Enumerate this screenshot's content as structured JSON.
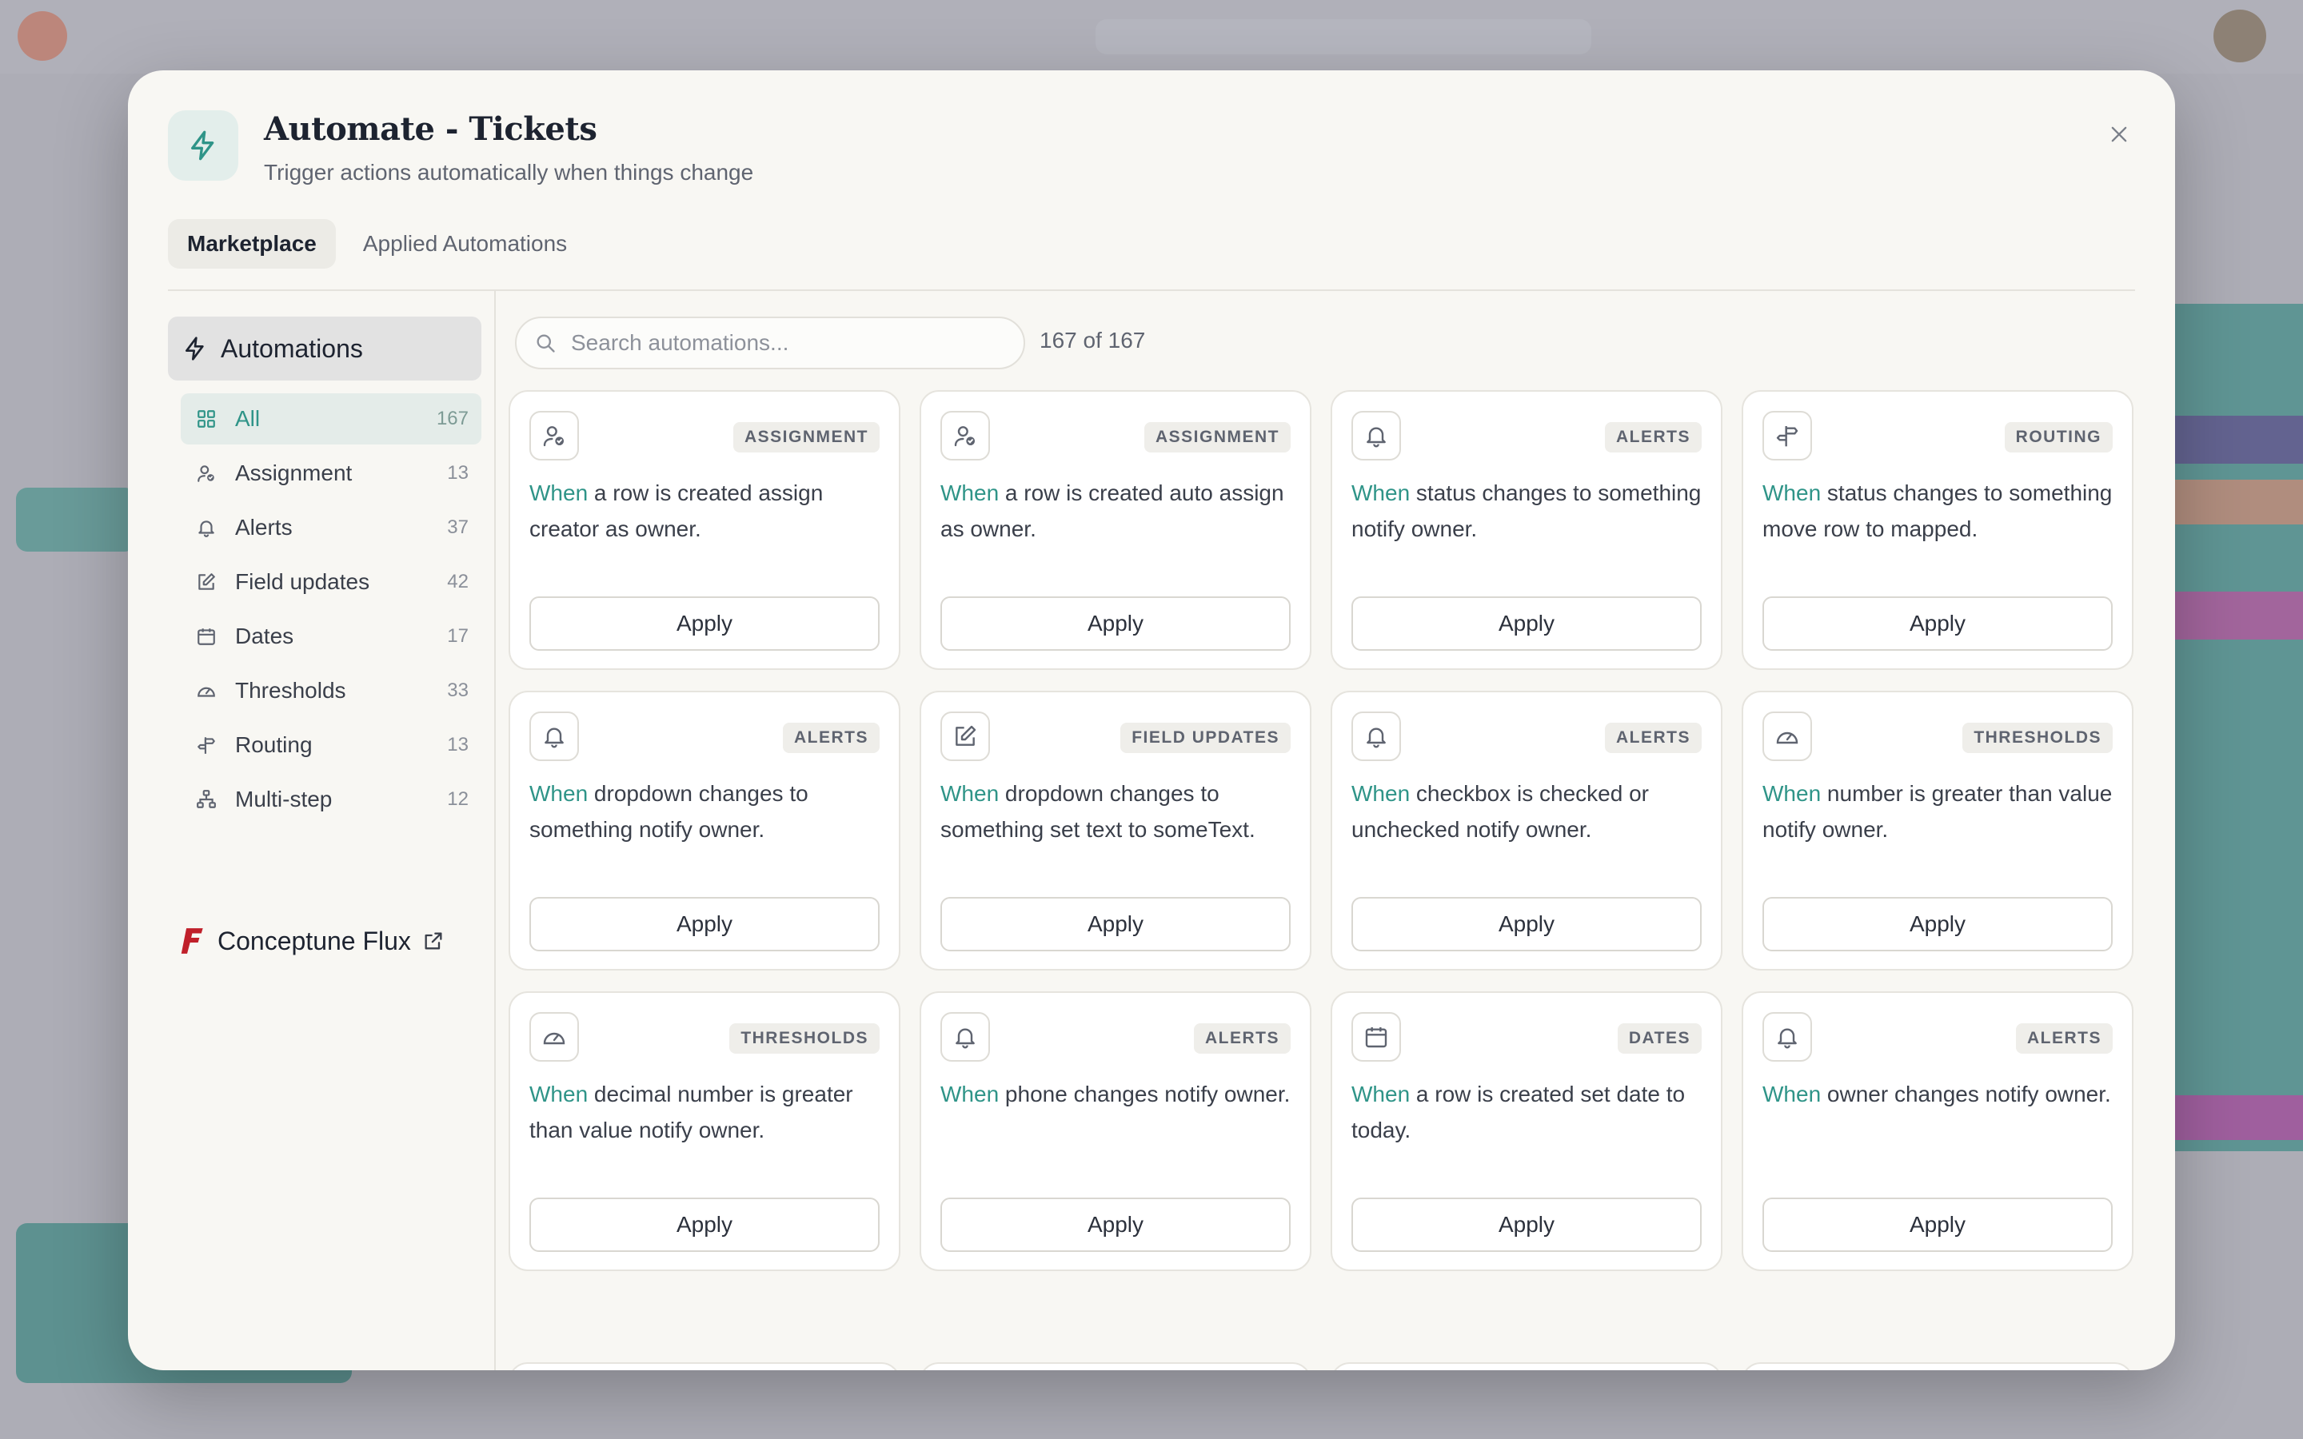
{
  "modal": {
    "title": "Automate - Tickets",
    "subtitle": "Trigger actions automatically when things change"
  },
  "tabs": [
    {
      "label": "Marketplace",
      "active": true
    },
    {
      "label": "Applied Automations",
      "active": false
    }
  ],
  "sidebar": {
    "header": "Automations",
    "items": [
      {
        "label": "All",
        "count": "167",
        "icon": "grid-icon",
        "active": true
      },
      {
        "label": "Assignment",
        "count": "13",
        "icon": "user-check-icon"
      },
      {
        "label": "Alerts",
        "count": "37",
        "icon": "bell-icon"
      },
      {
        "label": "Field updates",
        "count": "42",
        "icon": "edit-icon"
      },
      {
        "label": "Dates",
        "count": "17",
        "icon": "calendar-icon"
      },
      {
        "label": "Thresholds",
        "count": "33",
        "icon": "gauge-icon"
      },
      {
        "label": "Routing",
        "count": "13",
        "icon": "signpost-icon"
      },
      {
        "label": "Multi-step",
        "count": "12",
        "icon": "workflow-icon"
      }
    ],
    "brand": "Conceptune Flux"
  },
  "search": {
    "placeholder": "Search automations...",
    "value": "",
    "result_count": "167 of 167"
  },
  "cards": [
    {
      "category": "ASSIGNMENT",
      "icon": "user-check-icon",
      "when": "When",
      "text": " a row is created assign creator as owner.",
      "apply": "Apply"
    },
    {
      "category": "ASSIGNMENT",
      "icon": "user-check-icon",
      "when": "When",
      "text": " a row is created auto assign as owner.",
      "apply": "Apply"
    },
    {
      "category": "ALERTS",
      "icon": "bell-icon",
      "when": "When",
      "text": " status changes to something notify owner.",
      "apply": "Apply"
    },
    {
      "category": "ROUTING",
      "icon": "signpost-icon",
      "when": "When",
      "text": " status changes to something move row to mapped.",
      "apply": "Apply"
    },
    {
      "category": "ALERTS",
      "icon": "bell-icon",
      "when": "When",
      "text": " dropdown changes to something notify owner.",
      "apply": "Apply"
    },
    {
      "category": "FIELD UPDATES",
      "icon": "edit-icon",
      "when": "When",
      "text": " dropdown changes to something set text to someText.",
      "apply": "Apply"
    },
    {
      "category": "ALERTS",
      "icon": "bell-icon",
      "when": "When",
      "text": " checkbox is checked or unchecked notify owner.",
      "apply": "Apply"
    },
    {
      "category": "THRESHOLDS",
      "icon": "gauge-icon",
      "when": "When",
      "text": " number is greater than value notify owner.",
      "apply": "Apply"
    },
    {
      "category": "THRESHOLDS",
      "icon": "gauge-icon",
      "when": "When",
      "text": " decimal number is greater than value notify owner.",
      "apply": "Apply"
    },
    {
      "category": "ALERTS",
      "icon": "bell-icon",
      "when": "When",
      "text": " phone changes notify owner.",
      "apply": "Apply"
    },
    {
      "category": "DATES",
      "icon": "calendar-icon",
      "when": "When",
      "text": " a row is created set date to today.",
      "apply": "Apply"
    },
    {
      "category": "ALERTS",
      "icon": "bell-icon",
      "when": "When",
      "text": " owner changes notify owner.",
      "apply": "Apply"
    }
  ],
  "colors": {
    "accent": "#2f9488",
    "brand_red": "#c0202a",
    "modal_bg": "#f8f7f3"
  }
}
